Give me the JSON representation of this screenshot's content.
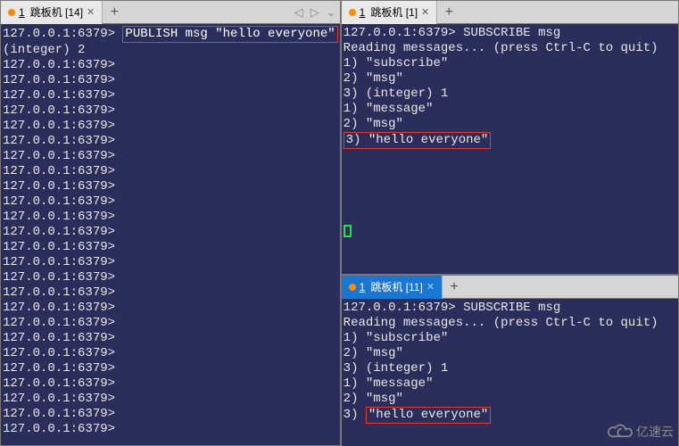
{
  "tabs": {
    "left": {
      "dot": true,
      "num": "1",
      "title": "跳板机 [14]"
    },
    "right_top": {
      "dot": true,
      "num": "1",
      "title": "跳板机 [1]"
    },
    "right_bot": {
      "dot": true,
      "num": "1",
      "title": "跳板机 [11]"
    }
  },
  "left_pane": {
    "prompt_text": "127.0.0.1:6379>",
    "command": "PUBLISH msg \"hello everyone\"",
    "result": "(integer) 2",
    "empty_prompt_count": 25
  },
  "right_top_pane": {
    "prompt_text": "127.0.0.1:6379>",
    "command": "SUBSCRIBE msg",
    "reading": "Reading messages... (press Ctrl-C to quit)",
    "lines": [
      "1) \"subscribe\"",
      "2) \"msg\"",
      "3) (integer) 1",
      "1) \"message\"",
      "2) \"msg\""
    ],
    "highlight_tag": "3)",
    "highlight_msg": "\"hello everyone\""
  },
  "right_bot_pane": {
    "prompt_text": "127.0.0.1:6379>",
    "command": "SUBSCRIBE msg",
    "reading": "Reading messages... (press Ctrl-C to quit)",
    "lines": [
      "1) \"subscribe\"",
      "2) \"msg\"",
      "3) (integer) 1",
      "1) \"message\"",
      "2) \"msg\""
    ],
    "highlight_tag": "3)",
    "highlight_msg": "\"hello everyone\""
  },
  "watermark": "亿速云",
  "arrow_icons": {
    "back": "◁",
    "fwd": "▷",
    "list": "⌄"
  }
}
